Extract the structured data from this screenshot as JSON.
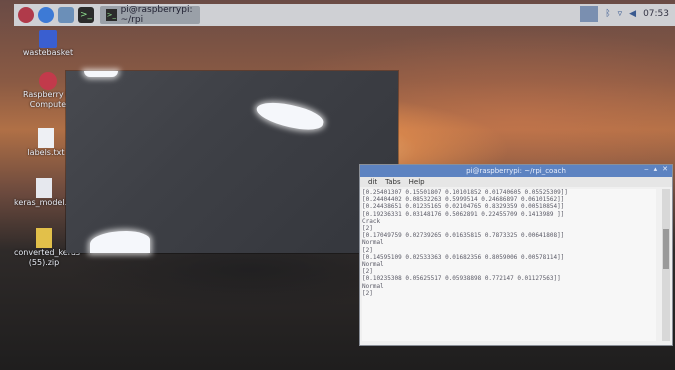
{
  "panel": {
    "task_label": "pi@raspberrypi: ~/rpi",
    "clock": "07:53"
  },
  "desktop_icons": [
    {
      "label": "wastebasket"
    },
    {
      "label": "Raspberry Pi Compute"
    },
    {
      "label": "labels.txt"
    },
    {
      "label": "keras_model.h5"
    },
    {
      "label": "converted_keras (55).zip"
    }
  ],
  "terminal": {
    "title": "pi@raspberrypi: ~/rpi_coach",
    "menu": [
      "dit",
      "Tabs",
      "Help"
    ],
    "lines": [
      "[0.25401307 0.15501807 0.10101852 0.01740605 0.05525309]]",
      "",
      "[0.24404402 0.08532263 0.5999514 0.24686897 0.06101562]]",
      "",
      "",
      "[0.24438651 0.01235165 0.02104765 0.8329359 0.00510854]]",
      "",
      "",
      "[0.19236331 0.03148176 0.5062891 0.22455709 0.1413989 ]]",
      "Crack",
      "[2]",
      "[0.17049759 0.02739265 0.01635815 0.7873325 0.00641808]]",
      "Normal",
      "[2]",
      "[0.14595109 0.02533363 0.01682356 0.8059006 0.00578114]]",
      "Normal",
      "[2]",
      "[0.10235308 0.05625517 0.05938898 0.772147 0.01127563]]",
      "Normal",
      "[2]"
    ]
  }
}
